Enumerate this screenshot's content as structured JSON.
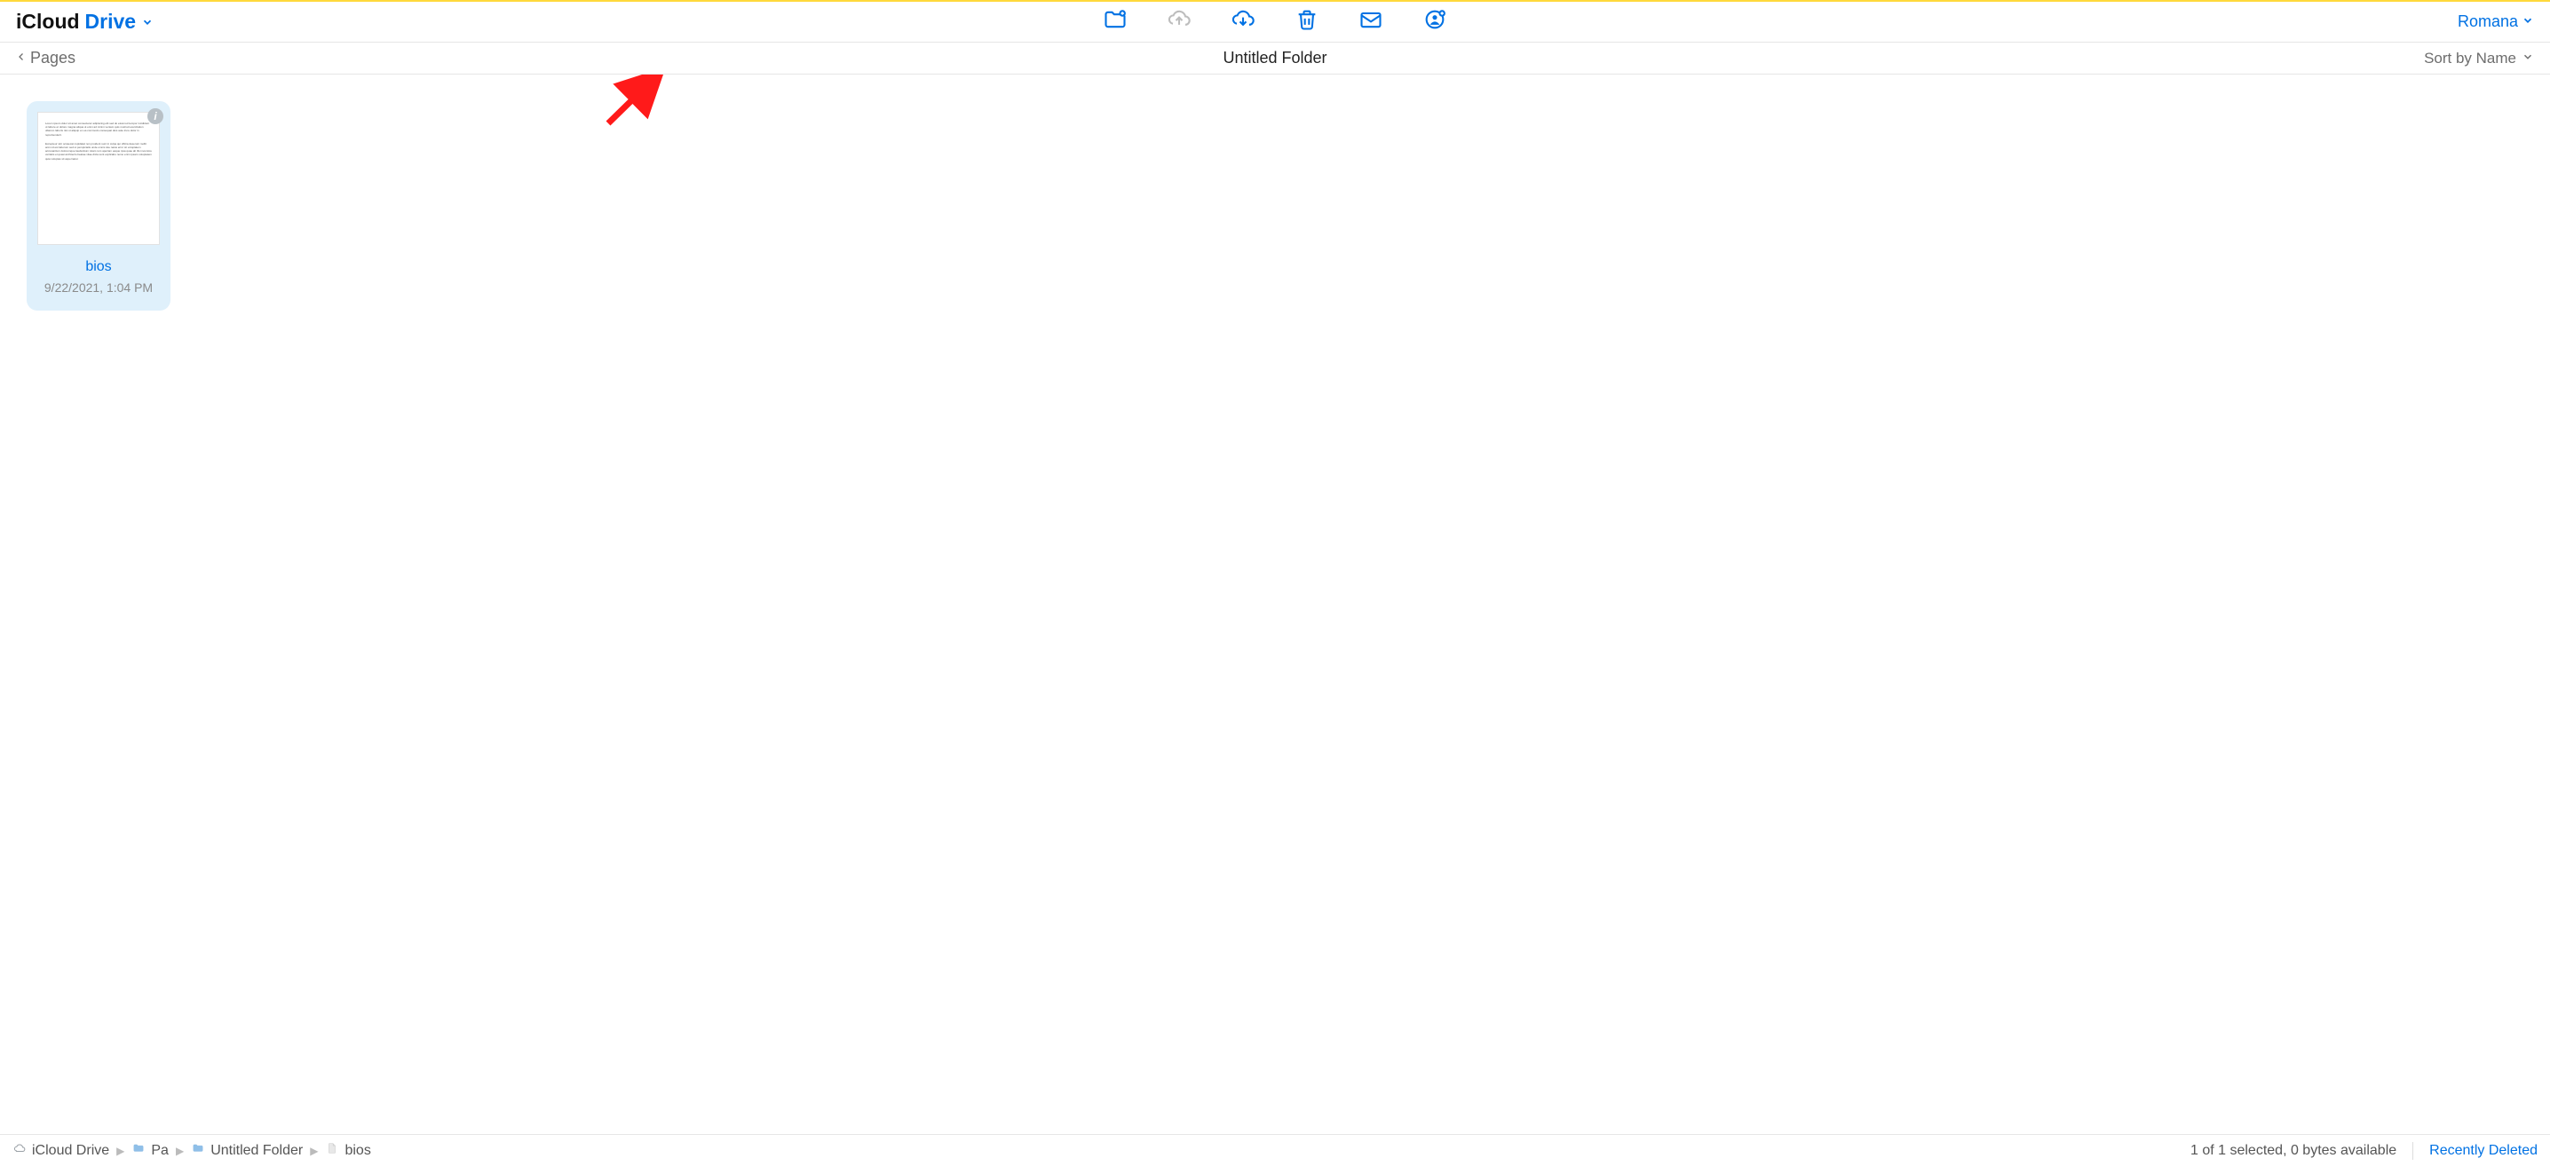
{
  "brand": {
    "icloud": "iCloud",
    "drive": "Drive"
  },
  "account": {
    "name": "Romana"
  },
  "toolbar": {
    "new_folder": "New Folder",
    "upload": "Upload",
    "download": "Download",
    "delete": "Delete",
    "email": "Email",
    "share": "Share"
  },
  "back": {
    "label": "Pages"
  },
  "folder": {
    "title": "Untitled Folder"
  },
  "sort": {
    "label": "Sort by Name"
  },
  "file": {
    "name": "bios",
    "date": "9/22/2021, 1:04 PM",
    "info_badge": "i"
  },
  "breadcrumb": {
    "root": "iCloud Drive",
    "l1": "Pa",
    "l2": "Untitled Folder",
    "l3": "bios"
  },
  "status": {
    "selection": "1 of 1 selected, 0 bytes available",
    "recent": "Recently Deleted"
  },
  "colors": {
    "accent": "#0071e3",
    "selected_bg": "#dff0fb"
  }
}
